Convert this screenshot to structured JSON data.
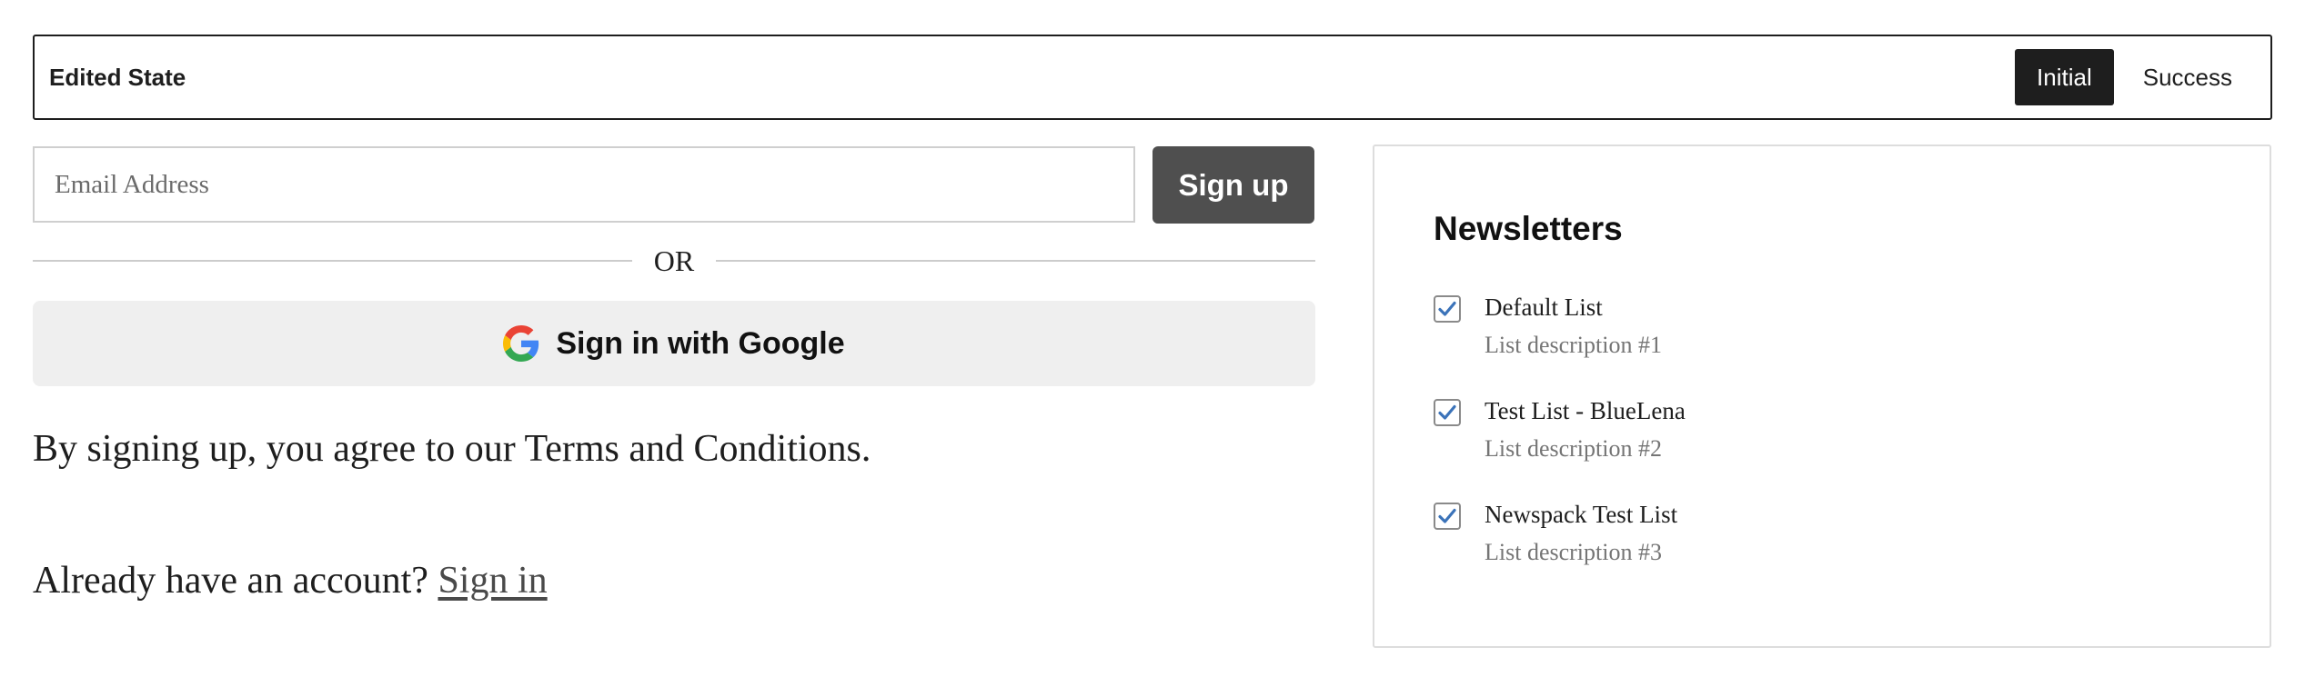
{
  "state_bar": {
    "title": "Edited State",
    "options": [
      "Initial",
      "Success"
    ],
    "selected": "Initial"
  },
  "signup": {
    "email_placeholder": "Email Address",
    "email_value": "",
    "button_label": "Sign up",
    "or_label": "OR",
    "google_button_label": "Sign in with Google",
    "google_icon": "google-g-logo-icon",
    "terms_text": "By signing up, you agree to our Terms and Conditions.",
    "account_prompt": "Already have an account?",
    "signin_link": "Sign in"
  },
  "newsletters": {
    "title": "Newsletters",
    "lists": [
      {
        "name": "Default List",
        "description": "List description #1",
        "checked": true
      },
      {
        "name": "Test List - BlueLena",
        "description": "List description #2",
        "checked": true
      },
      {
        "name": "Newspack Test List",
        "description": "List description #3",
        "checked": true
      }
    ]
  },
  "colors": {
    "accent_check": "#3b73b9",
    "signup_button": "#4f4f4f",
    "google_button_bg": "#efefef",
    "toggle_active_bg": "#1e1e1e"
  }
}
